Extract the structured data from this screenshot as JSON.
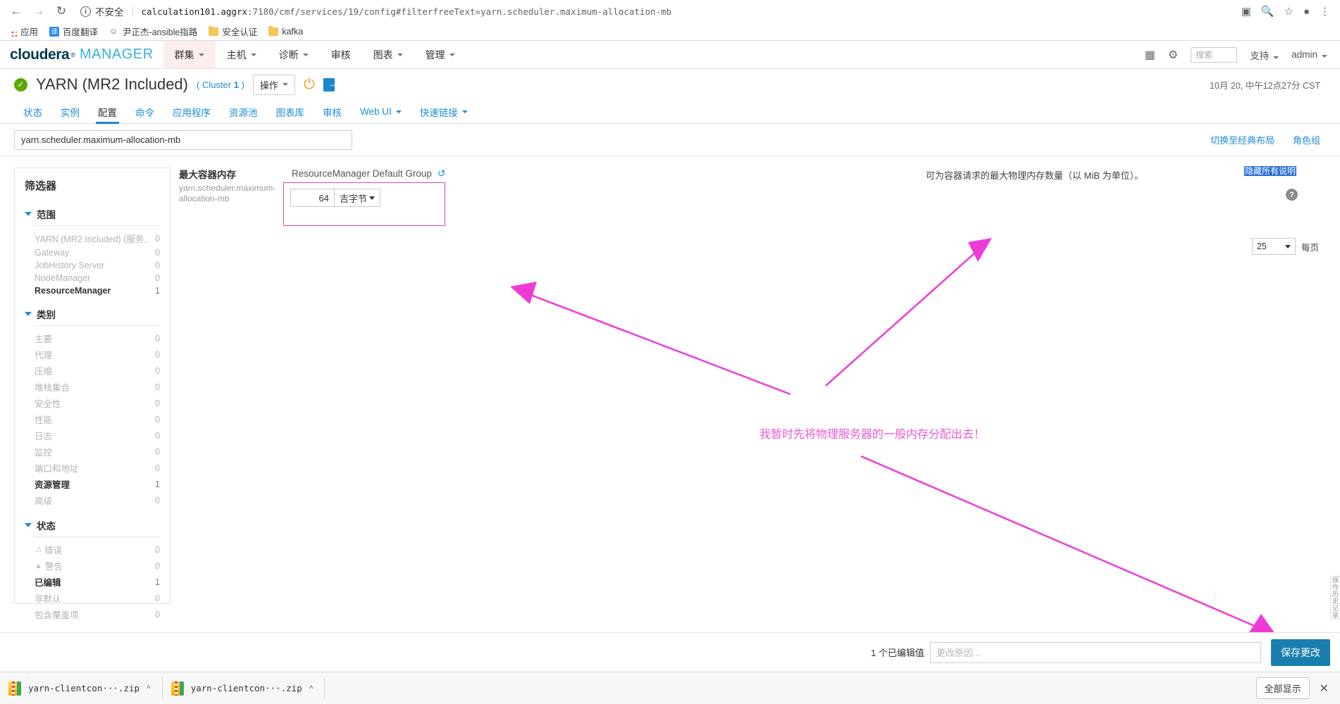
{
  "browser": {
    "back_icon": "back-arrow",
    "forward_icon": "forward-arrow",
    "reload_icon": "reload",
    "security_label": "不安全",
    "url_host": "calculation101.aggrx",
    "url_rest": ":7180/cmf/services/19/config#filterfreeText=yarn.scheduler.maximum-allocation-mb",
    "bookmarks": [
      {
        "label": "应用",
        "icon": "apps-grid-icon"
      },
      {
        "label": "百度翻译",
        "icon": "translate-icon"
      },
      {
        "label": "尹正杰-ansible指路",
        "icon": "person-icon"
      },
      {
        "label": "安全认证",
        "icon": "folder-icon"
      },
      {
        "label": "kafka",
        "icon": "folder-icon"
      }
    ]
  },
  "cm_header": {
    "logo_main": "cloudera",
    "logo_reg": "®",
    "logo_sub": "MANAGER",
    "nav": [
      {
        "label": "群集",
        "has_caret": true,
        "active": true
      },
      {
        "label": "主机",
        "has_caret": true,
        "active": false
      },
      {
        "label": "诊断",
        "has_caret": true,
        "active": false
      },
      {
        "label": "审核",
        "has_caret": false,
        "active": false
      },
      {
        "label": "图表",
        "has_caret": true,
        "active": false
      },
      {
        "label": "管理",
        "has_caret": true,
        "active": false
      }
    ],
    "search_placeholder": "搜索",
    "support_label": "支持",
    "user_label": "admin"
  },
  "service": {
    "status_icon": "check-circle-icon",
    "name": "YARN (MR2 Included)",
    "cluster_prefix": "( Cluster ",
    "cluster_num": "1",
    "cluster_suffix": " )",
    "actions_label": "操作",
    "timestamp": "10月 20, 中午12点27分 CST"
  },
  "tabs": [
    {
      "label": "状态",
      "active": false,
      "caret": false
    },
    {
      "label": "实例",
      "active": false,
      "caret": false
    },
    {
      "label": "配置",
      "active": true,
      "caret": false
    },
    {
      "label": "命令",
      "active": false,
      "caret": false
    },
    {
      "label": "应用程序",
      "active": false,
      "caret": false
    },
    {
      "label": "资源池",
      "active": false,
      "caret": false
    },
    {
      "label": "图表库",
      "active": false,
      "caret": false
    },
    {
      "label": "审核",
      "active": false,
      "caret": false
    },
    {
      "label": "Web UI",
      "active": false,
      "caret": true
    },
    {
      "label": "快速链接",
      "active": false,
      "caret": true
    }
  ],
  "filter_row": {
    "search_value": "yarn.scheduler.maximum-allocation-mb",
    "switch_layout": "切换至经典布局",
    "role_groups": "角色组"
  },
  "filters": {
    "title": "筛选器",
    "groups": [
      {
        "name": "范围",
        "items": [
          {
            "label": "YARN (MR2 Included) (服务...",
            "count": "0",
            "selected": false
          },
          {
            "label": "Gateway",
            "count": "0",
            "selected": false
          },
          {
            "label": "JobHistory Server",
            "count": "0",
            "selected": false
          },
          {
            "label": "NodeManager",
            "count": "0",
            "selected": false
          },
          {
            "label": "ResourceManager",
            "count": "1",
            "selected": true
          }
        ]
      },
      {
        "name": "类别",
        "items": [
          {
            "label": "主要",
            "count": "0",
            "selected": false
          },
          {
            "label": "代理",
            "count": "0",
            "selected": false
          },
          {
            "label": "压缩",
            "count": "0",
            "selected": false
          },
          {
            "label": "堆栈集合",
            "count": "0",
            "selected": false
          },
          {
            "label": "安全性",
            "count": "0",
            "selected": false
          },
          {
            "label": "性能",
            "count": "0",
            "selected": false
          },
          {
            "label": "日志",
            "count": "0",
            "selected": false
          },
          {
            "label": "监控",
            "count": "0",
            "selected": false
          },
          {
            "label": "端口和地址",
            "count": "0",
            "selected": false
          },
          {
            "label": "资源管理",
            "count": "1",
            "selected": true
          },
          {
            "label": "高级",
            "count": "0",
            "selected": false
          }
        ]
      },
      {
        "name": "状态",
        "items": [
          {
            "label": "错误",
            "count": "0",
            "selected": false,
            "icon": "error-icon"
          },
          {
            "label": "警告",
            "count": "0",
            "selected": false,
            "icon": "warning-icon"
          },
          {
            "label": "已编辑",
            "count": "1",
            "selected": true,
            "icon": ""
          },
          {
            "label": "非默认",
            "count": "0",
            "selected": false,
            "icon": ""
          },
          {
            "label": "包含覆盖项",
            "count": "0",
            "selected": false,
            "icon": ""
          }
        ]
      }
    ]
  },
  "config": {
    "hide_all_desc": "隐藏所有说明",
    "property": {
      "display_name": "最大容器内存",
      "key": "yarn.scheduler.maximum-allocation-mb",
      "group_name": "ResourceManager Default Group",
      "reset_icon": "reset-icon",
      "value": "64",
      "unit": "吉字节",
      "description": "可为容器请求的最大物理内存数量（以 MiB 为单位）。",
      "help_icon": "help-icon"
    },
    "per_page_value": "25",
    "per_page_label": "每页",
    "side_tab_label": "操作历史记录"
  },
  "annotation": {
    "text": "我暂时先将物理服务器的一般内存分配出去！",
    "color": "#e85ad0"
  },
  "save_bar": {
    "edited_count_label": "1 个已编辑值",
    "reason_placeholder": "更改原因...",
    "save_label": "保存更改"
  },
  "downloads": {
    "items": [
      {
        "name": "yarn-clientcon···.zip",
        "icon": "zip-file-icon"
      },
      {
        "name": "yarn-clientcon···.zip",
        "icon": "zip-file-icon"
      }
    ],
    "show_all_label": "全部显示",
    "close_icon": "close-icon"
  }
}
